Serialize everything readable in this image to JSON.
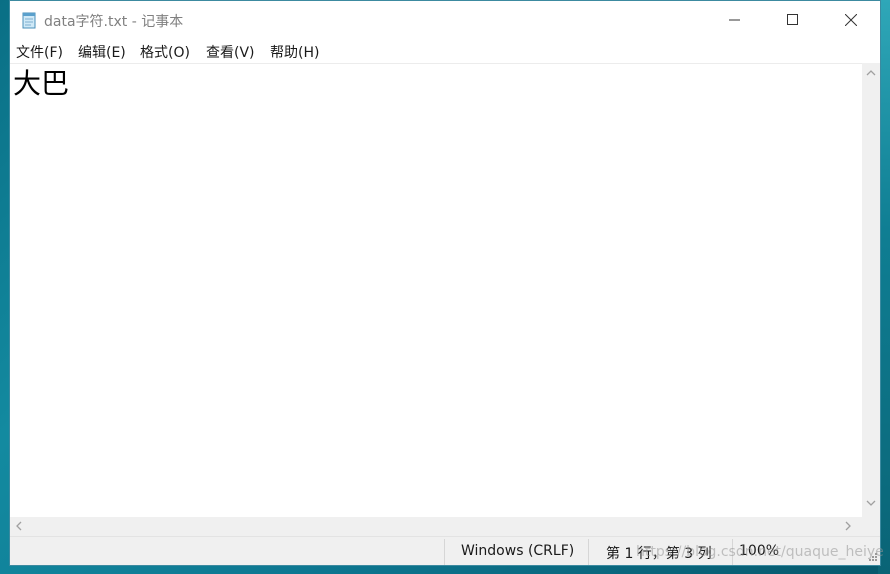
{
  "window": {
    "title": "data字符.txt - 记事本",
    "controls": {
      "minimize_icon": "minimize-icon",
      "maximize_icon": "maximize-icon",
      "close_icon": "close-icon"
    }
  },
  "menu": {
    "items": [
      {
        "label": "文件(F)"
      },
      {
        "label": "编辑(E)"
      },
      {
        "label": "格式(O)"
      },
      {
        "label": "查看(V)"
      },
      {
        "label": "帮助(H)"
      }
    ]
  },
  "editor": {
    "content": "大巴"
  },
  "statusbar": {
    "line_ending": "Windows (CRLF)",
    "position": "第 1 行，第 3 列",
    "zoom": "100%"
  },
  "watermark": "https://blog.csdn.net/quaque_heiye",
  "colors": {
    "desktop": "#0d7791",
    "window_bg": "#ffffff",
    "chrome": "#f0f0f0",
    "title_text": "#808080"
  }
}
